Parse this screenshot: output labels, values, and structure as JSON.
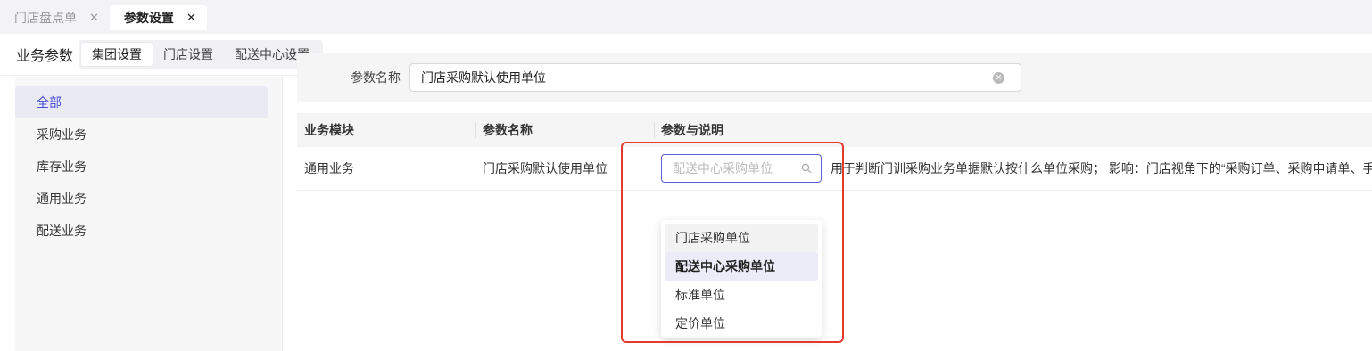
{
  "tabs": [
    {
      "label": "门店盘点单",
      "close": "✕"
    },
    {
      "label": "参数设置",
      "close": "✕"
    }
  ],
  "header": {
    "title": "业务参数",
    "segments": [
      "集团设置",
      "门店设置",
      "配送中心设置"
    ]
  },
  "sidebar": {
    "items": [
      {
        "label": "全部"
      },
      {
        "label": "采购业务"
      },
      {
        "label": "库存业务"
      },
      {
        "label": "通用业务"
      },
      {
        "label": "配送业务"
      }
    ]
  },
  "filter": {
    "label": "参数名称",
    "value": "门店采购默认使用单位"
  },
  "table": {
    "columns": [
      "业务模块",
      "参数名称",
      "参数与说明"
    ],
    "row": {
      "module": "通用业务",
      "name": "门店采购默认使用单位",
      "select_placeholder": "配送中心采购单位",
      "description": "用于判断门训采购业务单据默认按什么单位采购； 影响：门店视角下的“采购订单、采购申请单、手"
    }
  },
  "dropdown": {
    "options": [
      "门店采购单位",
      "配送中心采购单位",
      "标准单位",
      "定价单位"
    ]
  },
  "colors": {
    "accent": "#5b5fd6",
    "sidebar_active_text": "#4a4fd8",
    "highlight_border": "#e53a2f"
  }
}
